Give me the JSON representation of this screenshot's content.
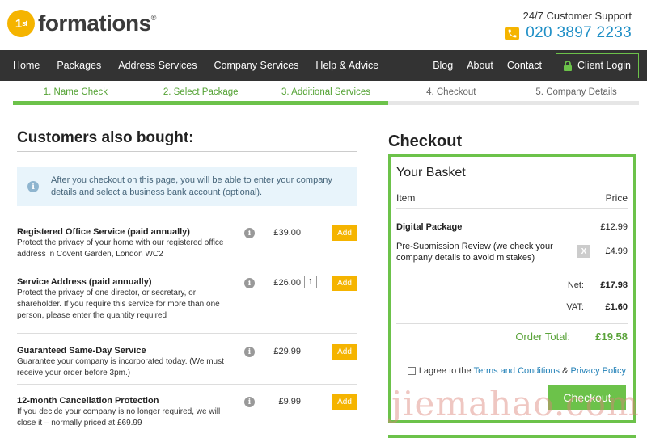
{
  "logo": {
    "badge_number": "1",
    "badge_suffix": "st",
    "text": "formations",
    "mark": "®"
  },
  "support": {
    "label": "24/7 Customer Support",
    "phone": "020 3897 2233",
    "icon": "phone-icon"
  },
  "nav": {
    "left": [
      "Home",
      "Packages",
      "Address Services",
      "Company Services",
      "Help & Advice"
    ],
    "right": [
      "Blog",
      "About",
      "Contact"
    ],
    "login": "Client Login"
  },
  "steps": [
    {
      "label": "1. Name Check",
      "state": "done"
    },
    {
      "label": "2. Select Package",
      "state": "done"
    },
    {
      "label": "3. Additional Services",
      "state": "done"
    },
    {
      "label": "4. Checkout",
      "state": "todo"
    },
    {
      "label": "5. Company Details",
      "state": "todo"
    }
  ],
  "upsell": {
    "title": "Customers also bought:",
    "info": "After you checkout on this page, you will be able to enter your company details and select a business bank account (optional).",
    "services": [
      {
        "name": "Registered Office Service (paid annually)",
        "desc": "Protect the privacy of your home with our registered office address in Covent Garden, London WC2",
        "price": "£39.00",
        "qty": "",
        "add": "Add"
      },
      {
        "name": "Service Address (paid annually)",
        "desc": "Protect the privacy of one director, or secretary, or shareholder. If you require this service for more than one person, please enter the quantity required",
        "price": "£26.00",
        "qty": "1",
        "add": "Add"
      },
      {
        "name": "Guaranteed Same-Day Service",
        "desc": "Guarantee your company is incorporated today. (We must receive your order before 3pm.)",
        "price": "£29.99",
        "qty": "",
        "add": "Add"
      },
      {
        "name": "12-month Cancellation Protection",
        "desc": "If you decide your company is no longer required, we will close it – normally priced at £69.99",
        "price": "£9.99",
        "qty": "",
        "add": "Add"
      }
    ]
  },
  "checkout": {
    "title": "Checkout",
    "basket_title": "Your Basket",
    "col_item": "Item",
    "col_price": "Price",
    "items": [
      {
        "name": "Digital Package",
        "price": "£12.99"
      },
      {
        "name": "Pre-Submission Review (we check your company details to avoid mistakes)",
        "price": "£4.99",
        "remove": "X"
      }
    ],
    "net_label": "Net:",
    "net": "£17.98",
    "vat_label": "VAT:",
    "vat": "£1.60",
    "total_label": "Order Total:",
    "total": "£19.58",
    "agree_prefix": "I agree to the",
    "terms": "Terms and Conditions",
    "amp": "&",
    "privacy": "Privacy Policy",
    "button": "Checkout"
  },
  "colors": {
    "brand_yellow": "#f5b400",
    "brand_green": "#6cc24a",
    "nav_bg": "#333333",
    "link_blue": "#1f8fc6"
  },
  "watermark": "jiemahao.com"
}
